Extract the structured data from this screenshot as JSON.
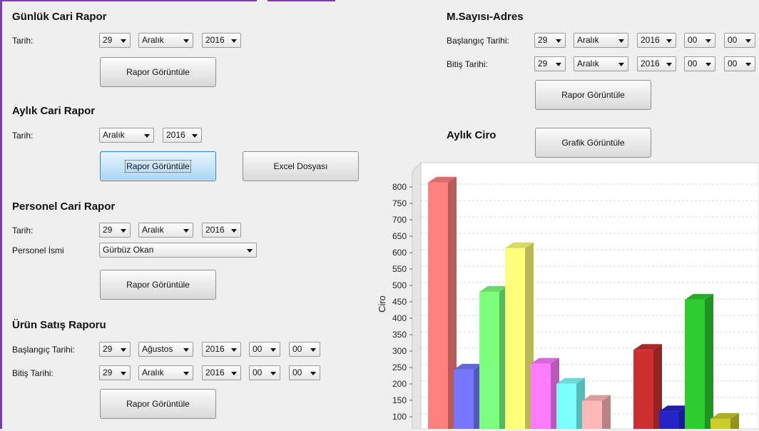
{
  "gunluk": {
    "title": "Günlük Cari Rapor",
    "date_label": "Tarih:",
    "day": "29",
    "month": "Aralık",
    "year": "2016",
    "button": "Rapor Görüntüle"
  },
  "aylik": {
    "title": "Aylık Cari Rapor",
    "date_label": "Tarih:",
    "month": "Aralık",
    "year": "2016",
    "button": "Rapor Görüntüle",
    "excel_button": "Excel Dosyası"
  },
  "personel": {
    "title": "Personel Cari Rapor",
    "date_label": "Tarih:",
    "day": "29",
    "month": "Aralık",
    "year": "2016",
    "name_label": "Personel İsmi",
    "name_value": "Gürbüz Okan",
    "button": "Rapor Görüntüle"
  },
  "urun": {
    "title": "Ürün Satış Raporu",
    "start_label": "Başlangıç Tarihi:",
    "start": {
      "day": "29",
      "month": "Ağustos",
      "year": "2016",
      "hour": "00",
      "minute": "00"
    },
    "end_label": "Bitiş Tarihi:",
    "end": {
      "day": "29",
      "month": "Aralık",
      "year": "2016",
      "hour": "00",
      "minute": "00"
    },
    "button": "Rapor Görüntüle"
  },
  "msayisi": {
    "title": "M.Sayısı-Adres",
    "start_label": "Başlangıç Tarihi:",
    "start": {
      "day": "29",
      "month": "Aralık",
      "year": "2016",
      "hour": "00",
      "minute": "00"
    },
    "end_label": "Bitiş Tarihi:",
    "end": {
      "day": "29",
      "month": "Aralık",
      "year": "2016",
      "hour": "00",
      "minute": "00"
    },
    "button": "Rapor Görüntüle"
  },
  "ciro": {
    "title": "Aylık Ciro",
    "button": "Grafik Görüntüle"
  },
  "chart_data": {
    "type": "bar",
    "title": "",
    "xlabel": "",
    "ylabel": "Ciro",
    "ylim": [
      70,
      820
    ],
    "yticks": [
      100,
      150,
      200,
      250,
      300,
      350,
      400,
      450,
      500,
      550,
      600,
      650,
      700,
      750,
      800
    ],
    "grid": true,
    "bars": [
      {
        "value": 805,
        "color": "#ff7f7f"
      },
      {
        "value": 235,
        "color": "#7676ff"
      },
      {
        "value": 472,
        "color": "#7cff7c"
      },
      {
        "value": 605,
        "color": "#ffff7a"
      },
      {
        "value": 253,
        "color": "#ff7cff"
      },
      {
        "value": 192,
        "color": "#7cffff"
      },
      {
        "value": 140,
        "color": "#ffb8b8"
      },
      {
        "value": 295,
        "color": "#cc2f2f"
      },
      {
        "value": 108,
        "color": "#2424c8"
      },
      {
        "value": 448,
        "color": "#2fcc2f"
      },
      {
        "value": 85,
        "color": "#cccc2a"
      }
    ]
  }
}
